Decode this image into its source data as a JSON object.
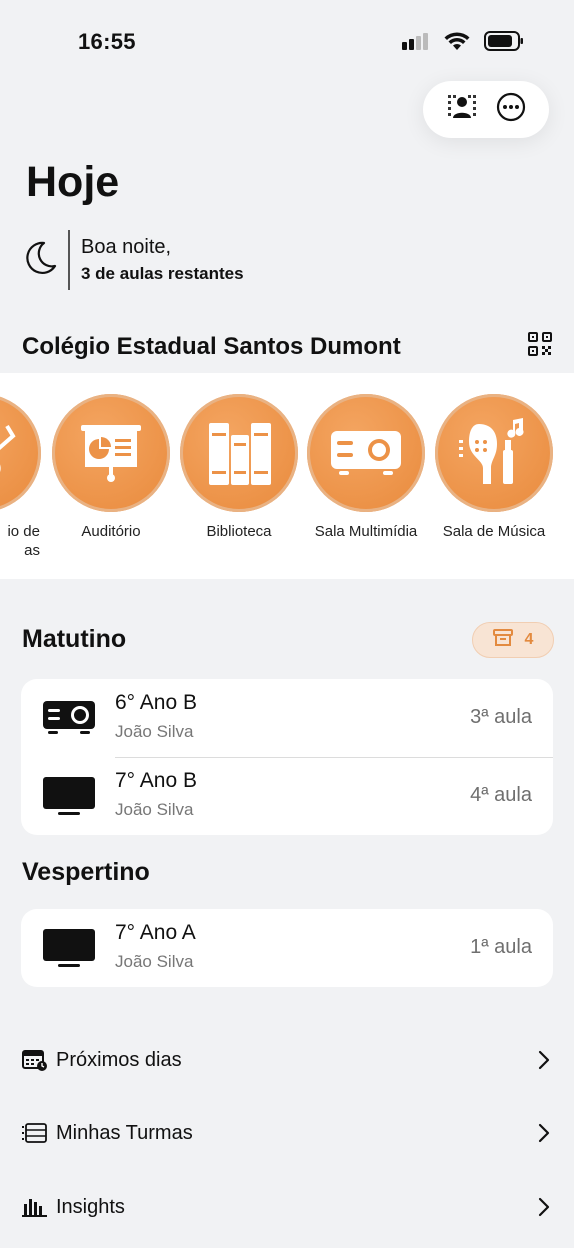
{
  "status_bar": {
    "time": "16:55"
  },
  "header": {
    "title": "Hoje"
  },
  "greeting": {
    "line1": "Boa noite,",
    "line2": "3 de aulas restantes"
  },
  "school": {
    "name": "Colégio Estadual Santos Dumont"
  },
  "rooms": [
    {
      "label": "io de\nas",
      "icon": "lab-icon"
    },
    {
      "label": "Auditório",
      "icon": "presentation-board-icon"
    },
    {
      "label": "Biblioteca",
      "icon": "books-icon"
    },
    {
      "label": "Sala Multimídia",
      "icon": "projector-icon"
    },
    {
      "label": "Sala de Música",
      "icon": "music-instruments-icon"
    }
  ],
  "accent_color": "#ec9247",
  "morning": {
    "title": "Matutino",
    "badge_count": "4",
    "lessons": [
      {
        "title": "6° Ano B",
        "teacher": "João Silva",
        "period": "3ª aula",
        "icon": "projector-icon"
      },
      {
        "title": "7° Ano B",
        "teacher": "João Silva",
        "period": "4ª aula",
        "icon": "tv-icon"
      }
    ]
  },
  "afternoon": {
    "title": "Vespertino",
    "lessons": [
      {
        "title": "7° Ano A",
        "teacher": "João Silva",
        "period": "1ª aula",
        "icon": "tv-icon"
      }
    ]
  },
  "menu": [
    {
      "label": "Próximos dias",
      "icon": "calendar-clock-icon"
    },
    {
      "label": "Minhas Turmas",
      "icon": "list-icon"
    },
    {
      "label": "Insights",
      "icon": "bar-chart-icon"
    }
  ]
}
